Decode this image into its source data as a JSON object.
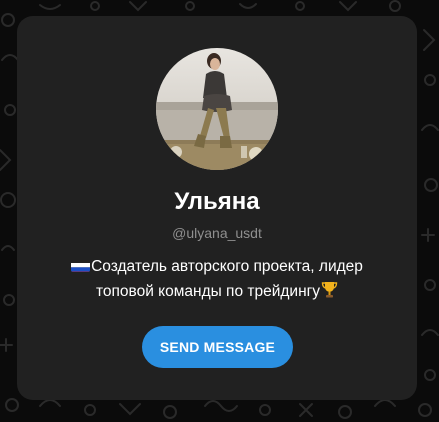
{
  "profile": {
    "name": "Ульяна",
    "username": "@ulyana_usdt",
    "bio_line1": "Создатель авторского проекта, лидер",
    "bio_line2": "топовой команды по трейдингу",
    "bio_prefix_icon": "russia-flag-icon",
    "bio_suffix_icon": "trophy-icon"
  },
  "actions": {
    "send_message_label": "SEND MESSAGE"
  },
  "colors": {
    "accent": "#2a8fe0",
    "card_background": "#212121",
    "page_background": "#0b0b0b",
    "muted_text": "#8f8f8f"
  }
}
